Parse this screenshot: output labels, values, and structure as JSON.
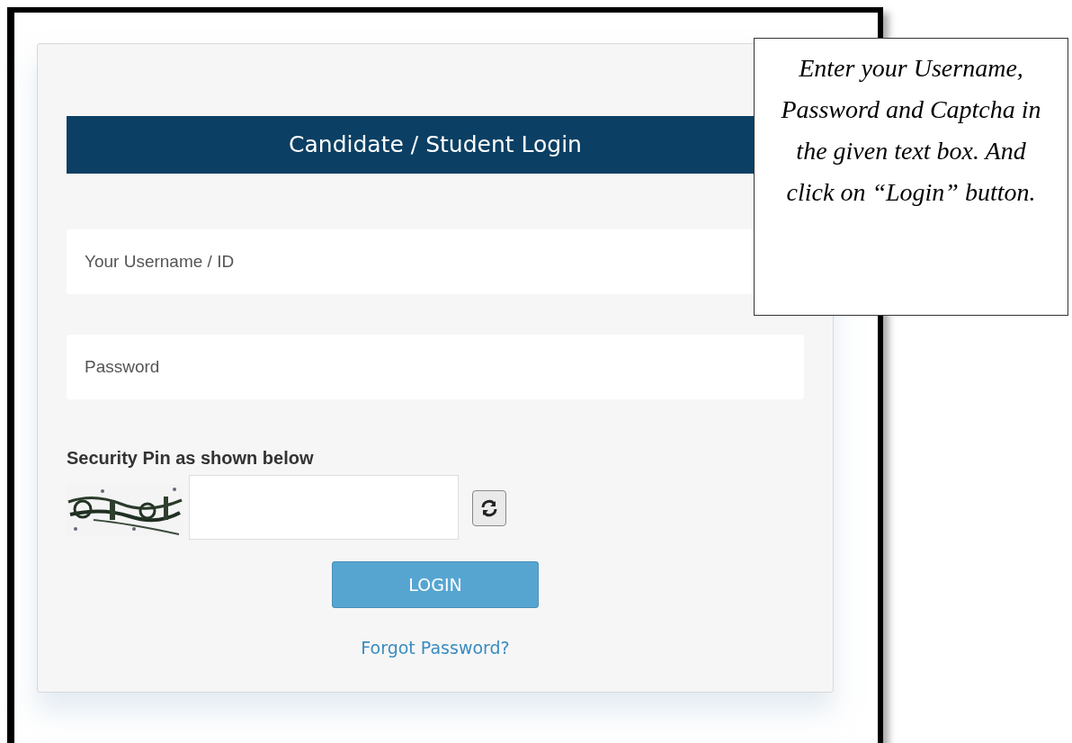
{
  "login_panel": {
    "title": "Candidate / Student Login",
    "fields": [
      {
        "placeholder": "Your Username / ID"
      },
      {
        "placeholder": "Password"
      }
    ],
    "captcha": {
      "label": "Security Pin as shown below"
    },
    "login_button": "LOGIN",
    "forgot_link": "Forgot Password?"
  },
  "callout": {
    "text": "Enter your Username, Password and Captcha in the given text box. And click on “Login” button."
  }
}
